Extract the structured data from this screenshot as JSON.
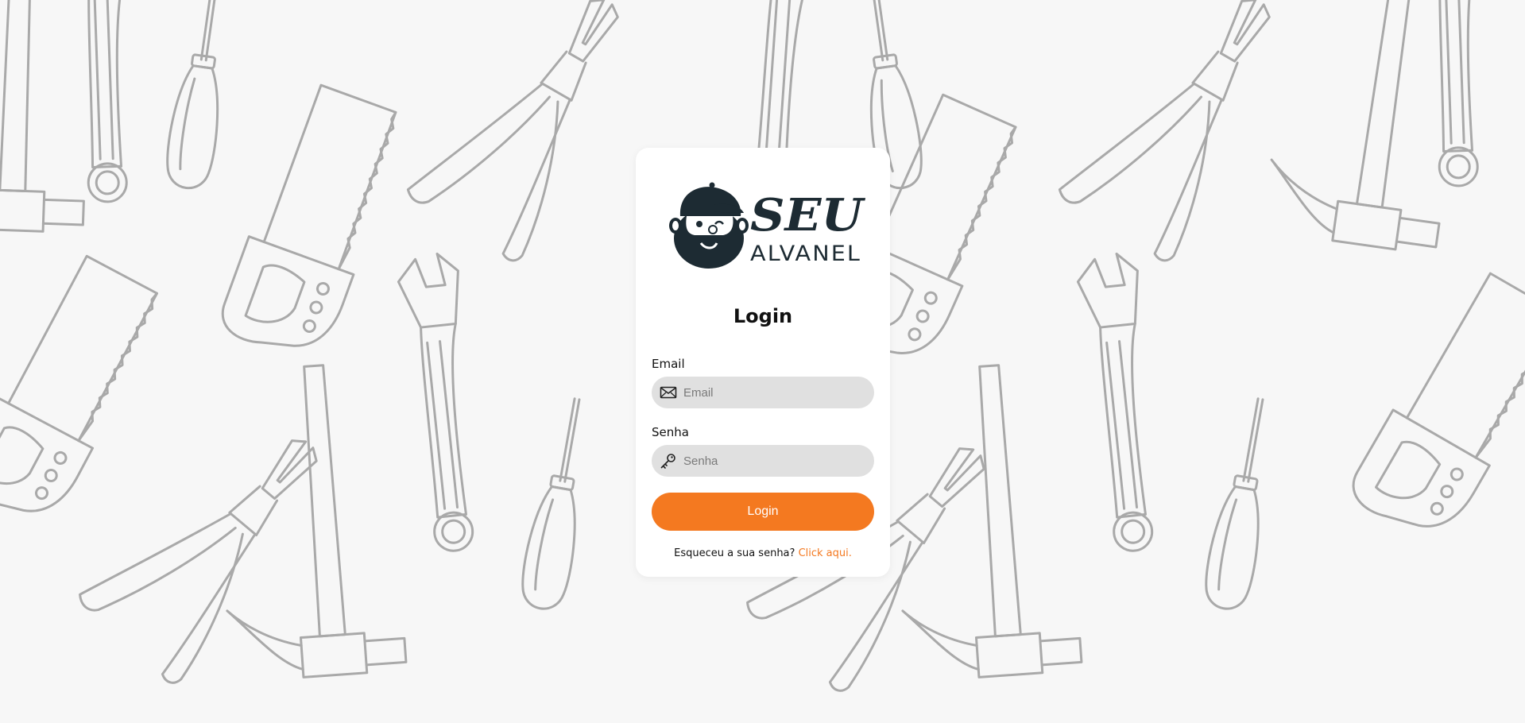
{
  "brand": {
    "logo_top": "SEU",
    "logo_bottom": "ALVANEL",
    "colors": {
      "dark": "#1d2b33",
      "accent": "#f47920"
    }
  },
  "login": {
    "title": "Login",
    "email_label": "Email",
    "email_placeholder": "Email",
    "email_value": "",
    "email_icon": "envelope-icon",
    "password_label": "Senha",
    "password_placeholder": "Senha",
    "password_value": "",
    "password_icon": "key-icon",
    "submit_label": "Login",
    "forgot_text": "Esqueceu a sua senha?",
    "forgot_link": "Click aqui."
  },
  "background": {
    "pattern": "hand-tools-line-art"
  },
  "colors": {
    "page_bg": "#f7f7f7",
    "field_bg": "#e0e0e0",
    "button": "#f47920",
    "link": "#f47920"
  }
}
